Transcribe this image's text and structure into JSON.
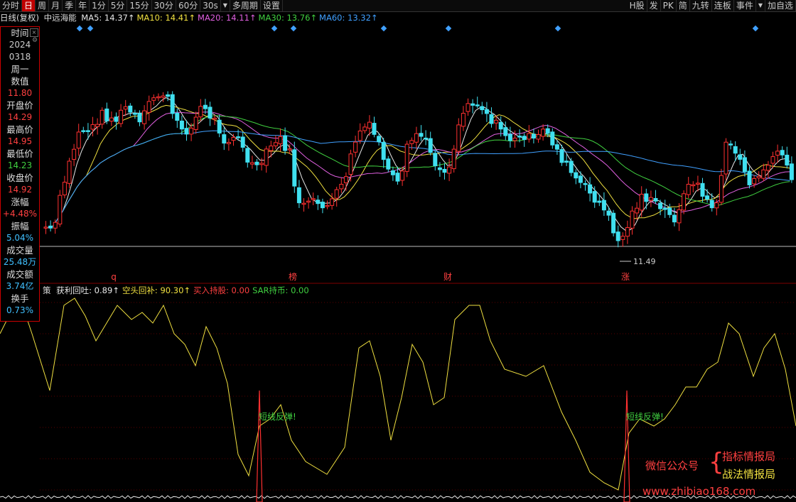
{
  "toolbar": {
    "tabs": [
      "分时",
      "日",
      "周",
      "月",
      "季",
      "年",
      "1分",
      "5分",
      "15分",
      "30分",
      "60分",
      "30s",
      "▼",
      "多周期",
      "设置"
    ],
    "active_index": 1,
    "right_tabs": [
      "H股",
      "发",
      "PK",
      "简",
      "九转",
      "连板",
      "事件",
      "▼",
      "加自选"
    ]
  },
  "info": {
    "chart_title": "日线(复权)",
    "stock_name": "中远海能",
    "ma": [
      {
        "label": "MA5: 14.37↑",
        "color": "#e8e8e8"
      },
      {
        "label": "MA10: 14.41↑",
        "color": "#f0e040"
      },
      {
        "label": "MA20: 14.11↑",
        "color": "#e060e0"
      },
      {
        "label": "MA30: 13.76↑",
        "color": "#40d040"
      },
      {
        "label": "MA60: 13.32↑",
        "color": "#40a0ff"
      }
    ]
  },
  "panel": {
    "items": [
      {
        "label": "时间",
        "value": "2024",
        "color": "#ccc"
      },
      {
        "label": "",
        "value": "0318",
        "color": "#ccc"
      },
      {
        "label": "周一",
        "value": "",
        "color": "#ccc"
      },
      {
        "label": "数值",
        "value": "11.80",
        "color": "#ff4040"
      },
      {
        "label": "开盘价",
        "value": "14.29",
        "color": "#ff4040"
      },
      {
        "label": "最高价",
        "value": "14.95",
        "color": "#ff4040"
      },
      {
        "label": "最低价",
        "value": "14.23",
        "color": "#40d040"
      },
      {
        "label": "收盘价",
        "value": "14.92",
        "color": "#ff4040"
      },
      {
        "label": "涨幅",
        "value": "+4.48%",
        "color": "#ff4040"
      },
      {
        "label": "振幅",
        "value": "5.04%",
        "color": "#40c0ff"
      },
      {
        "label": "成交量",
        "value": "25.48万",
        "color": "#40c0ff"
      },
      {
        "label": "成交额",
        "value": "3.74亿",
        "color": "#40c0ff"
      },
      {
        "label": "换手",
        "value": "0.73%",
        "color": "#40c0ff"
      }
    ],
    "close_label": "×",
    "gear_label": "⚙"
  },
  "price_labels": {
    "low": "11.49"
  },
  "event_markers": [
    "q",
    "榜",
    "财",
    "涨"
  ],
  "indicator": {
    "name": "策",
    "items": [
      {
        "label": "获利回吐: 0.89↑",
        "color": "#e8e8e8"
      },
      {
        "label": "空头回补: 90.30↑",
        "color": "#f0e040"
      },
      {
        "label": "买入持股: 0.00",
        "color": "#ff4040"
      },
      {
        "label": "SAR持币: 0.00",
        "color": "#40d040"
      }
    ],
    "signal_text": "短线反弹!"
  },
  "watermark": {
    "wechat": "微信公众号",
    "line1": "指标情报局",
    "line2": "战法情报局",
    "url": "www.zhibiao168.com"
  },
  "colors": {
    "up": "#ff3030",
    "down": "#40e0f0",
    "grid": "#800000"
  }
}
